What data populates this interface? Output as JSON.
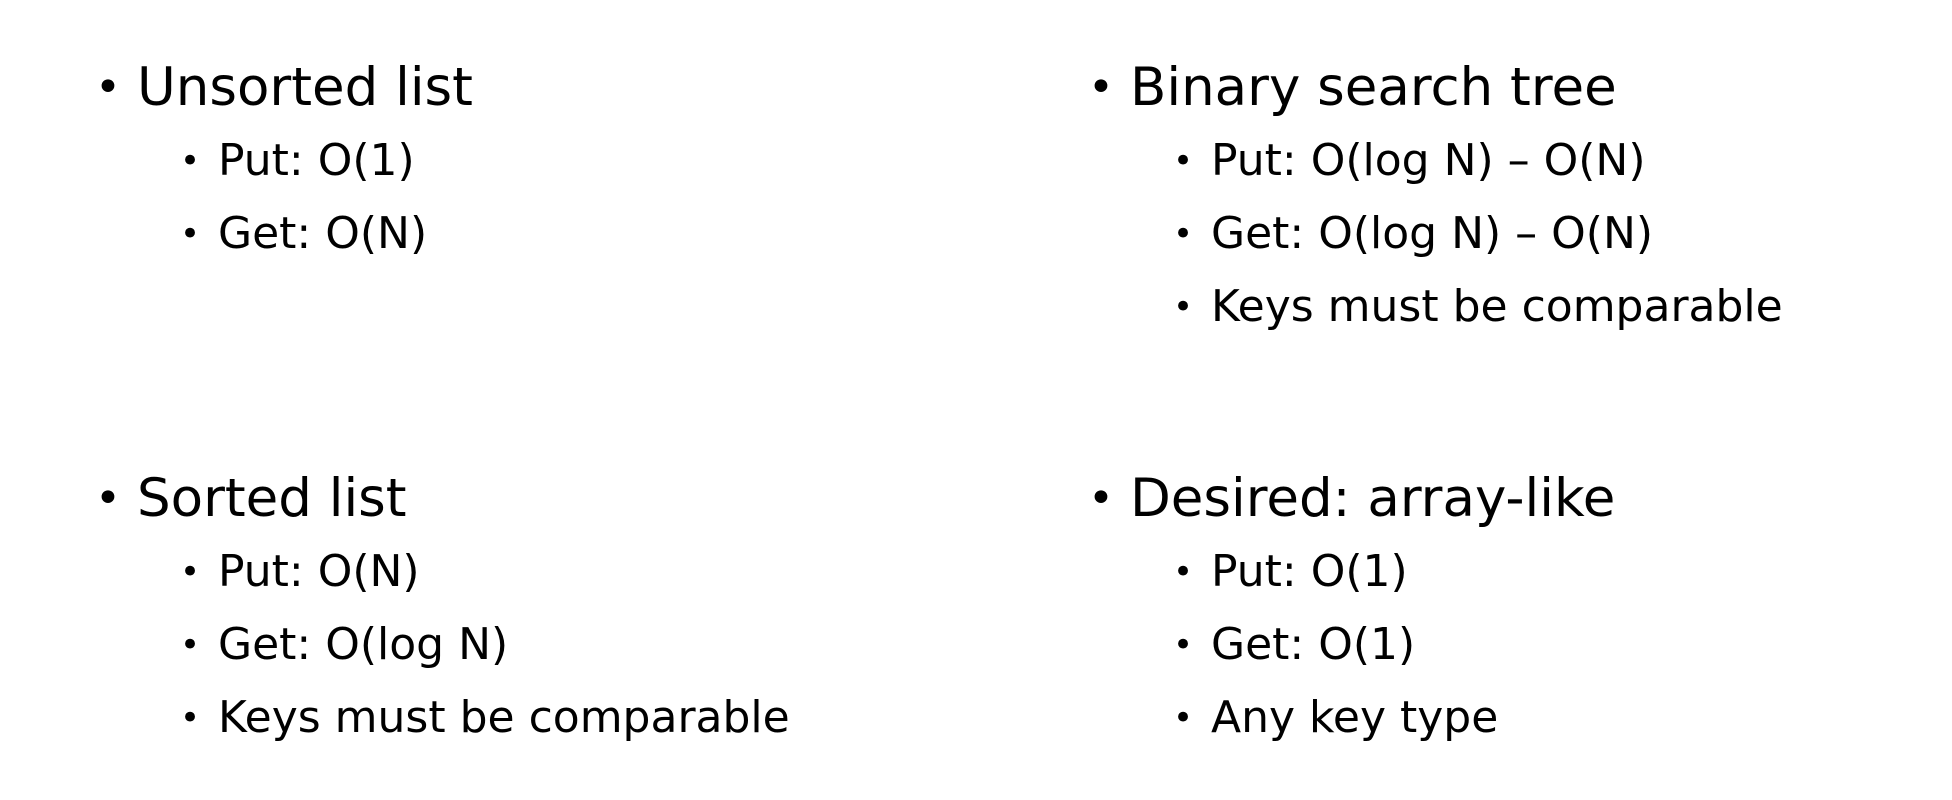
{
  "groups": {
    "unsorted_list": {
      "heading": "Unsorted list",
      "items": [
        "Put: O(1)",
        "Get: O(N)"
      ]
    },
    "binary_search_tree": {
      "heading": "Binary search tree",
      "items": [
        "Put: O(log N) – O(N)",
        "Get: O(log N) – O(N)",
        "Keys must be comparable"
      ]
    },
    "sorted_list": {
      "heading": "Sorted list",
      "items": [
        "Put: O(N)",
        "Get: O(log N)",
        "Keys must be comparable"
      ]
    },
    "desired": {
      "heading": "Desired: array-like",
      "items": [
        "Put: O(1)",
        "Get: O(1)",
        "Any key type"
      ]
    }
  },
  "bullet_glyph": "•"
}
